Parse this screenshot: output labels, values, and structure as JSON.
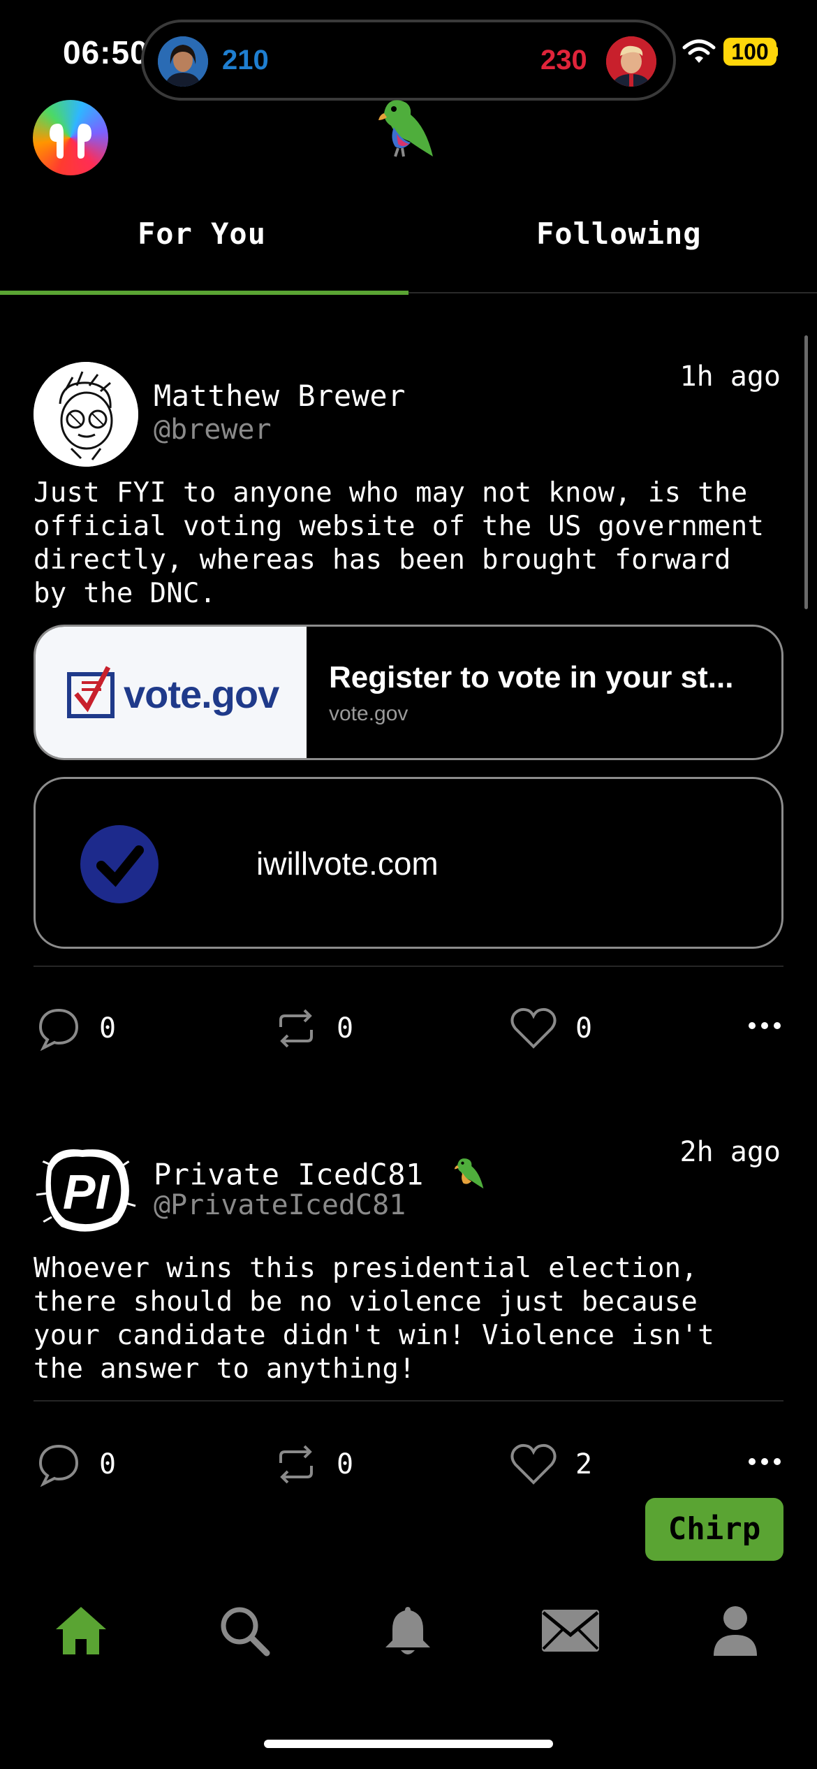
{
  "status_bar": {
    "time": "06:50",
    "election": {
      "left_votes": "210",
      "right_votes": "230",
      "left_color": "#1f7fd1",
      "right_color": "#e0243a"
    },
    "battery": "100"
  },
  "tabs": [
    {
      "label": "For You"
    },
    {
      "label": "Following"
    }
  ],
  "accent_color": "#5aa433",
  "posts": [
    {
      "name": "Matthew Brewer",
      "handle": "@brewer",
      "time": "1h ago",
      "text": "Just FYI to anyone who may not know, is the official voting website of the US government directly, whereas has been brought forward by the DNC.",
      "links": [
        {
          "title": "Register to vote in your st...",
          "domain": "vote.gov",
          "logo_text": "vote.gov"
        },
        {
          "domain": "iwillvote.com"
        }
      ],
      "replies": "0",
      "reposts": "0",
      "likes": "0"
    },
    {
      "name": "Private IcedC81",
      "handle": "@PrivateIcedC81",
      "time": "2h ago",
      "avatar_text": "PI",
      "text": "Whoever wins this presidential election, there should be no violence just because your candidate didn't win! Violence isn't the answer to anything!",
      "replies": "0",
      "reposts": "0",
      "likes": "2"
    }
  ],
  "chirp_button": "Chirp",
  "nav": [
    "home-icon",
    "search-icon",
    "bell-icon",
    "mail-icon",
    "profile-icon"
  ]
}
